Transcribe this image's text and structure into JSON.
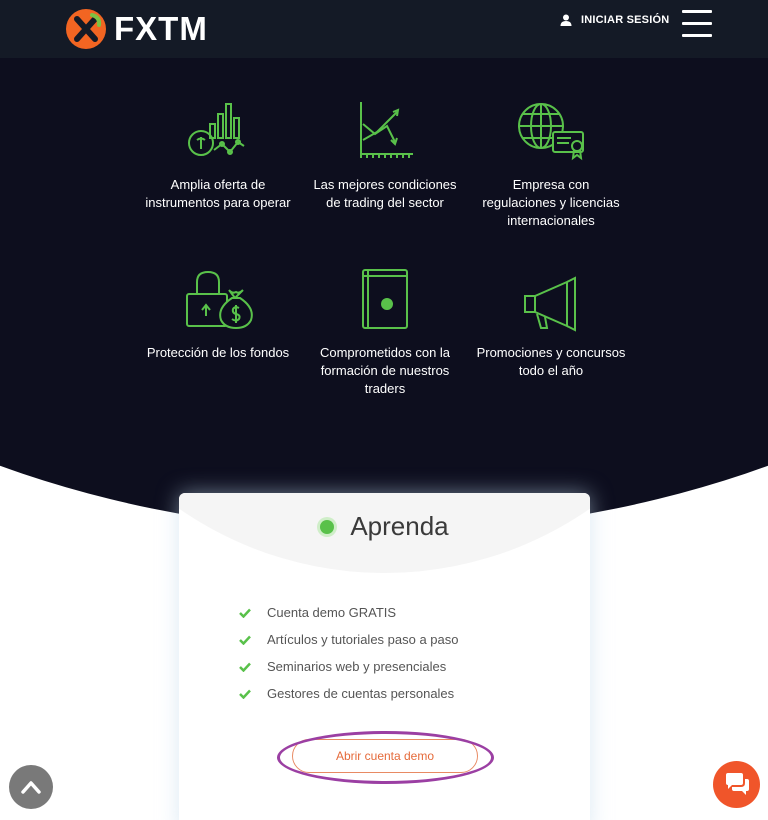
{
  "header": {
    "brand": "FXTM",
    "login_label": "INICIAR SESIÓN"
  },
  "features": [
    {
      "icon": "chart-instruments-icon",
      "label": "Amplia oferta de instrumentos para operar"
    },
    {
      "icon": "trading-graph-icon",
      "label": "Las mejores condiciones de trading del sector"
    },
    {
      "icon": "globe-certificate-icon",
      "label": "Empresa con regulaciones y licencias internacionales"
    },
    {
      "icon": "lock-moneybag-icon",
      "label": "Protección de los fondos"
    },
    {
      "icon": "education-book-icon",
      "label": "Comprometidos con la formación de nuestros traders"
    },
    {
      "icon": "megaphone-icon",
      "label": "Promociones y concursos todo el año"
    }
  ],
  "card": {
    "title": "Aprenda",
    "bullets": [
      "Cuenta demo GRATIS",
      "Artículos y tutoriales paso a paso",
      "Seminarios web y presenciales",
      "Gestores de cuentas personales"
    ],
    "cta_label": "Abrir cuenta demo"
  },
  "colors": {
    "header_bg": "#141a26",
    "hero_bg": "#0d0e1e",
    "accent_green": "#59c14a",
    "cta_orange": "#e56a3a",
    "highlight_purple": "#9b3fa3"
  }
}
